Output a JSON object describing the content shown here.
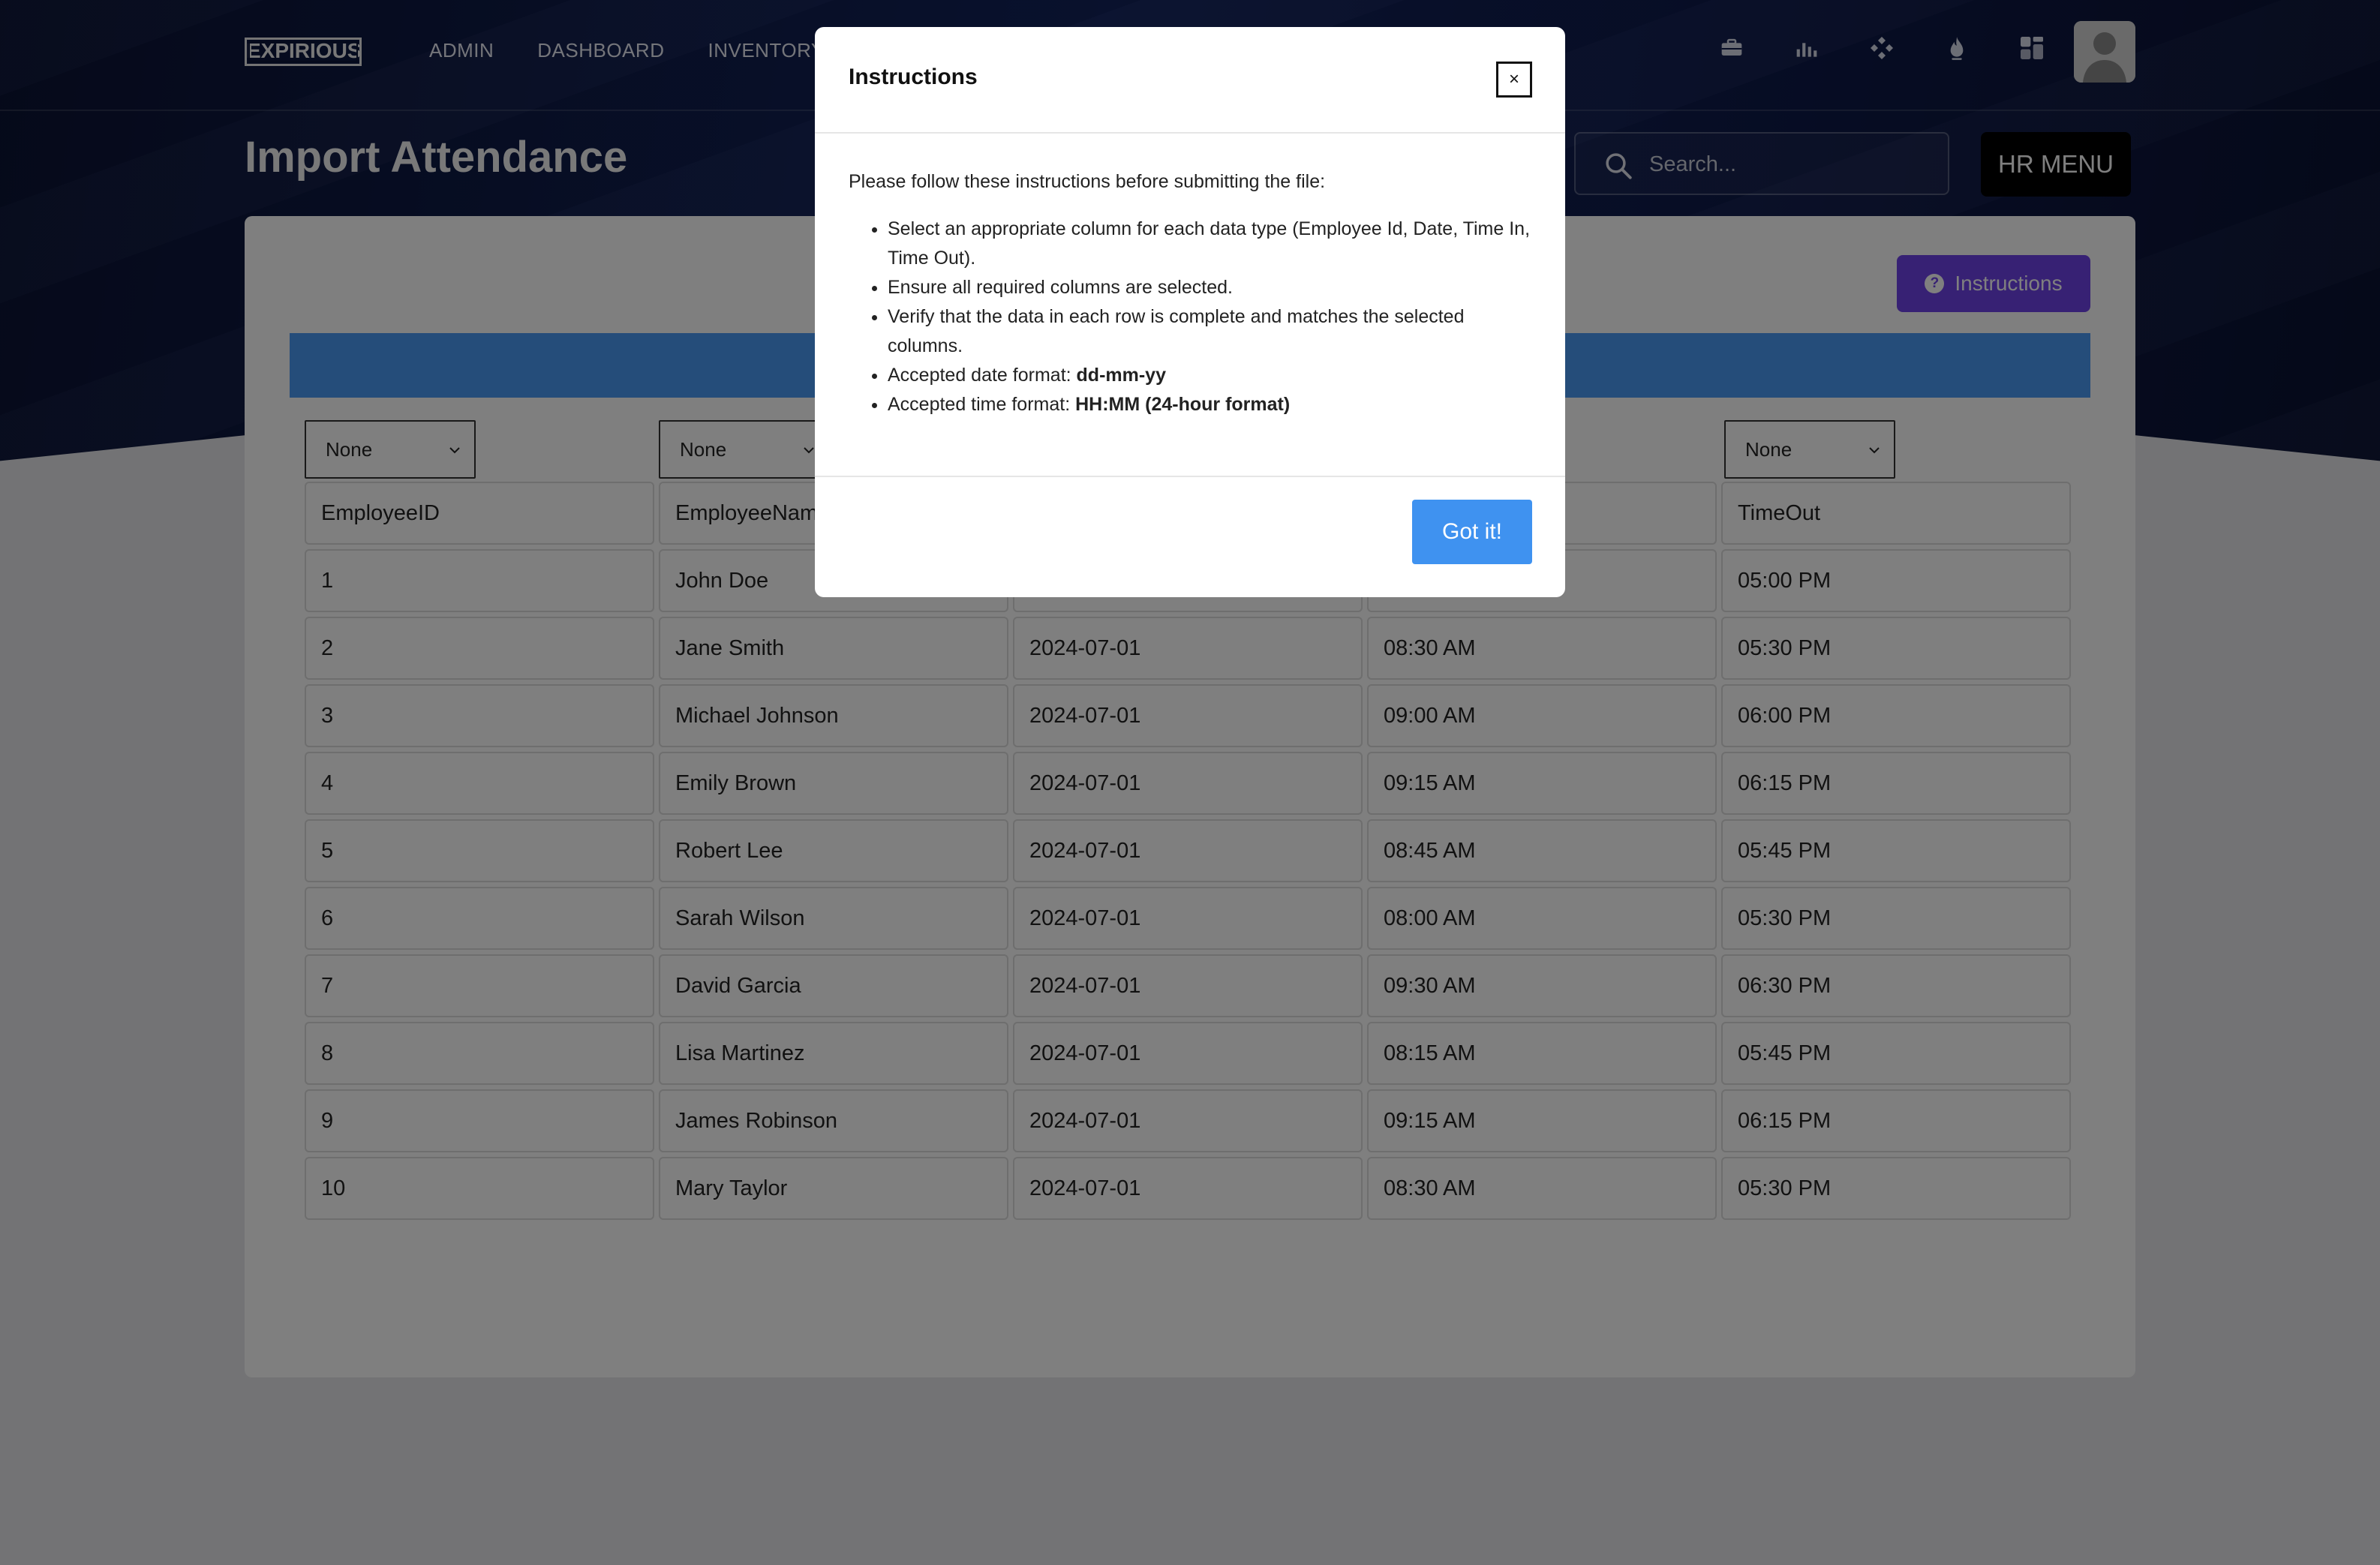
{
  "app": {
    "logo": "EXPIRIOUS",
    "nav": [
      "ADMIN",
      "DASHBOARD",
      "INVENTORY"
    ],
    "icons": [
      "briefcase-icon",
      "bar-chart-icon",
      "diamond-grid-icon",
      "flame-icon",
      "dashboard-grid-icon"
    ],
    "hr_menu": "HR MENU"
  },
  "page": {
    "title": "Import Attendance",
    "search_placeholder": "Search...",
    "instructions_button": "Instructions",
    "column_selects": [
      "None",
      "None",
      "None"
    ],
    "headers": [
      "EmployeeID",
      "EmployeeName",
      "",
      "",
      "TimeOut"
    ],
    "rows": [
      [
        "1",
        "John Doe",
        "",
        "",
        "05:00 PM"
      ],
      [
        "2",
        "Jane Smith",
        "2024-07-01",
        "08:30 AM",
        "05:30 PM"
      ],
      [
        "3",
        "Michael Johnson",
        "2024-07-01",
        "09:00 AM",
        "06:00 PM"
      ],
      [
        "4",
        "Emily Brown",
        "2024-07-01",
        "09:15 AM",
        "06:15 PM"
      ],
      [
        "5",
        "Robert Lee",
        "2024-07-01",
        "08:45 AM",
        "05:45 PM"
      ],
      [
        "6",
        "Sarah Wilson",
        "2024-07-01",
        "08:00 AM",
        "05:30 PM"
      ],
      [
        "7",
        "David Garcia",
        "2024-07-01",
        "09:30 AM",
        "06:30 PM"
      ],
      [
        "8",
        "Lisa Martinez",
        "2024-07-01",
        "08:15 AM",
        "05:45 PM"
      ],
      [
        "9",
        "James Robinson",
        "2024-07-01",
        "09:15 AM",
        "06:15 PM"
      ],
      [
        "10",
        "Mary Taylor",
        "2024-07-01",
        "08:30 AM",
        "05:30 PM"
      ]
    ]
  },
  "modal": {
    "title": "Instructions",
    "close": "×",
    "intro": "Please follow these instructions before submitting the file:",
    "items": [
      {
        "text": "Select an appropriate column for each data type (Employee Id, Date, Time In, Time Out).",
        "bold": ""
      },
      {
        "text": "Ensure all required columns are selected.",
        "bold": ""
      },
      {
        "text": "Verify that the data in each row is complete and matches the selected columns.",
        "bold": ""
      },
      {
        "text": "Accepted date format: ",
        "bold": "dd-mm-yy"
      },
      {
        "text": "Accepted time format: ",
        "bold": "HH:MM (24-hour format)"
      }
    ],
    "confirm": "Got it!"
  },
  "colors": {
    "accent_purple": "#6f42e8",
    "accent_blue": "#4a9bf5",
    "nav_dark": "#0b1436"
  }
}
